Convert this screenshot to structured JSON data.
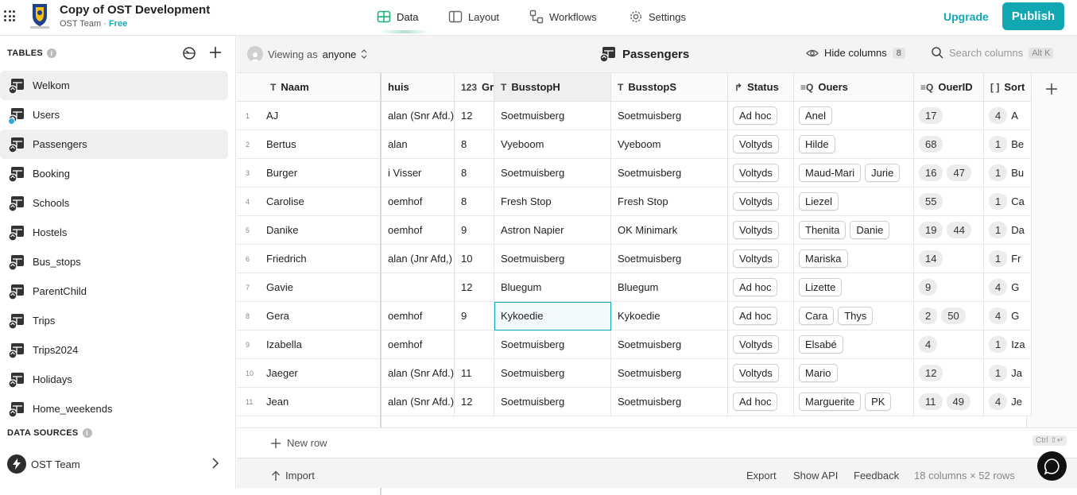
{
  "app": {
    "title": "Copy of OST Development",
    "team": "OST Team",
    "plan": "Free"
  },
  "nav": {
    "data": "Data",
    "layout": "Layout",
    "workflows": "Workflows",
    "settings": "Settings"
  },
  "actions": {
    "upgrade": "Upgrade",
    "publish": "Publish"
  },
  "sidebar": {
    "tables_label": "TABLES",
    "tables": [
      "Welkom",
      "Users",
      "Passengers",
      "Booking",
      "Schools",
      "Hostels",
      "Bus_stops",
      "ParentChild",
      "Trips",
      "Trips2024",
      "Holidays",
      "Home_weekends"
    ],
    "data_sources_label": "DATA SOURCES",
    "data_source": "OST Team"
  },
  "toolbar": {
    "viewing_prefix": "Viewing as",
    "viewing_value": "anyone",
    "table_title": "Passengers",
    "hide_columns": "Hide columns",
    "hidden_count": "8",
    "search_placeholder": "Search columns",
    "search_shortcut": "Alt K"
  },
  "columns": [
    {
      "label": "Naam",
      "type_icon": "T"
    },
    {
      "label": "huis",
      "type_icon": ""
    },
    {
      "label": "Gra",
      "type_icon": "123"
    },
    {
      "label": "BusstopH",
      "type_icon": "T"
    },
    {
      "label": "BusstopS",
      "type_icon": "T"
    },
    {
      "label": "Status",
      "type_icon": "↱"
    },
    {
      "label": "Ouers",
      "type_icon": "≡Q"
    },
    {
      "label": "OuerID",
      "type_icon": "≡Q"
    },
    {
      "label": "Sort",
      "type_icon": "[ ]"
    }
  ],
  "rows": [
    {
      "n": "1",
      "naam": "AJ",
      "huis": "alan (Snr Afd.)",
      "gr": "12",
      "bh": "Soetmuisberg",
      "bs": "Soetmuisberg",
      "status": "Ad hoc",
      "ouers": [
        "Anel"
      ],
      "ids": [
        "17"
      ],
      "sort": "4",
      "s2": "A"
    },
    {
      "n": "2",
      "naam": "Bertus",
      "huis": "alan",
      "gr": "8",
      "bh": "Vyeboom",
      "bs": "Vyeboom",
      "status": "Voltyds",
      "ouers": [
        "Hilde"
      ],
      "ids": [
        "68"
      ],
      "sort": "1",
      "s2": "Be"
    },
    {
      "n": "3",
      "naam": "Burger",
      "huis": "i Visser",
      "gr": "8",
      "bh": "Soetmuisberg",
      "bs": "Soetmuisberg",
      "status": "Voltyds",
      "ouers": [
        "Maud-Mari",
        "Jurie"
      ],
      "ids": [
        "16",
        "47"
      ],
      "sort": "1",
      "s2": "Bu"
    },
    {
      "n": "4",
      "naam": "Carolise",
      "huis": "oemhof",
      "gr": "8",
      "bh": "Fresh Stop",
      "bs": "Fresh Stop",
      "status": "Voltyds",
      "ouers": [
        "Liezel"
      ],
      "ids": [
        "55"
      ],
      "sort": "1",
      "s2": "Ca"
    },
    {
      "n": "5",
      "naam": "Danike",
      "huis": "oemhof",
      "gr": "9",
      "bh": "Astron Napier",
      "bs": "OK Minimark",
      "status": "Voltyds",
      "ouers": [
        "Thenita",
        "Danie"
      ],
      "ids": [
        "19",
        "44"
      ],
      "sort": "1",
      "s2": "Da"
    },
    {
      "n": "6",
      "naam": "Friedrich",
      "huis": "alan (Jnr Afd,)",
      "gr": "10",
      "bh": "Soetmuisberg",
      "bs": "Soetmuisberg",
      "status": "Voltyds",
      "ouers": [
        "Mariska"
      ],
      "ids": [
        "14"
      ],
      "sort": "1",
      "s2": "Fr"
    },
    {
      "n": "7",
      "naam": "Gavie",
      "huis": "",
      "gr": "12",
      "bh": "Bluegum",
      "bs": "Bluegum",
      "status": "Ad hoc",
      "ouers": [
        "Lizette"
      ],
      "ids": [
        "9"
      ],
      "sort": "4",
      "s2": "G"
    },
    {
      "n": "8",
      "naam": "Gera",
      "huis": "oemhof",
      "gr": "9",
      "bh": "Kykoedie",
      "bs": "Kykoedie",
      "status": "Ad hoc",
      "ouers": [
        "Cara",
        "Thys"
      ],
      "ids": [
        "2",
        "50"
      ],
      "sort": "4",
      "s2": "G"
    },
    {
      "n": "9",
      "naam": "Izabella",
      "huis": "oemhof",
      "gr": "",
      "bh": "Soetmuisberg",
      "bs": "Soetmuisberg",
      "status": "Voltyds",
      "ouers": [
        "Elsabé"
      ],
      "ids": [
        "4"
      ],
      "sort": "1",
      "s2": "Iza"
    },
    {
      "n": "10",
      "naam": "Jaeger",
      "huis": "alan (Snr Afd.)",
      "gr": "11",
      "bh": "Soetmuisberg",
      "bs": "Soetmuisberg",
      "status": "Voltyds",
      "ouers": [
        "Mario"
      ],
      "ids": [
        "12"
      ],
      "sort": "1",
      "s2": "Ja"
    },
    {
      "n": "11",
      "naam": "Jean",
      "huis": "alan (Snr Afd.)",
      "gr": "12",
      "bh": "Soetmuisberg",
      "bs": "Soetmuisberg",
      "status": "Ad hoc",
      "ouers": [
        "Marguerite",
        "PK"
      ],
      "ids": [
        "11",
        "49"
      ],
      "sort": "4",
      "s2": "Je"
    }
  ],
  "new_row": "New row",
  "footer": {
    "import": "Import",
    "export": "Export",
    "show_api": "Show API",
    "feedback": "Feedback",
    "stats": "18 columns × 52 rows",
    "ctrl": "Ctrl ⇧↵"
  },
  "colors": {
    "accent": "#12a8b3",
    "data_green": "#1ab478"
  }
}
